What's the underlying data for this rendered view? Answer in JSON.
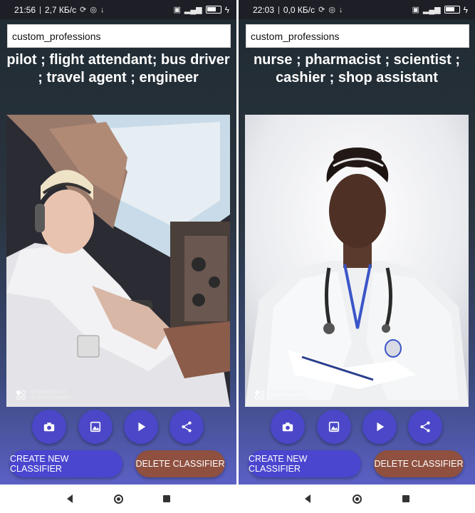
{
  "left_phone": {
    "status": {
      "time": "21:56",
      "speed": "2,7 КБ/с",
      "battery": "35"
    },
    "classifier_name": "custom_professions",
    "labels_line": "pilot ;  flight attendant;  bus driver ; travel agent ;  engineer",
    "photo_icon": "pilot-in-cockpit-photo",
    "watermark": {
      "line1": "REDMI NOTE 8T",
      "line2": "AI QUAD CAMERA"
    },
    "buttons": {
      "create": "CREATE NEW CLASSIFIER",
      "delete": "DELETE CLASSIFIER"
    }
  },
  "right_phone": {
    "status": {
      "time": "22:03",
      "speed": "0,0 КБ/с",
      "battery": "33"
    },
    "classifier_name": "custom_professions",
    "labels_line": "nurse ;  pharmacist ; scientist ; cashier ; shop assistant",
    "photo_icon": "nurse-with-stethoscope-photo",
    "watermark": {
      "line1": "REDMI NOTE 8T",
      "line2": "AI QUAD CAMERA"
    },
    "buttons": {
      "create": "CREATE NEW CLASSIFIER",
      "delete": "DELETE CLASSIFIER"
    }
  },
  "fab_icons": [
    "camera-icon",
    "gallery-icon",
    "play-icon",
    "share-icon"
  ],
  "colors": {
    "accent": "#4b47c8",
    "delete": "#8f5040",
    "statusbar": "#1e1e27"
  }
}
